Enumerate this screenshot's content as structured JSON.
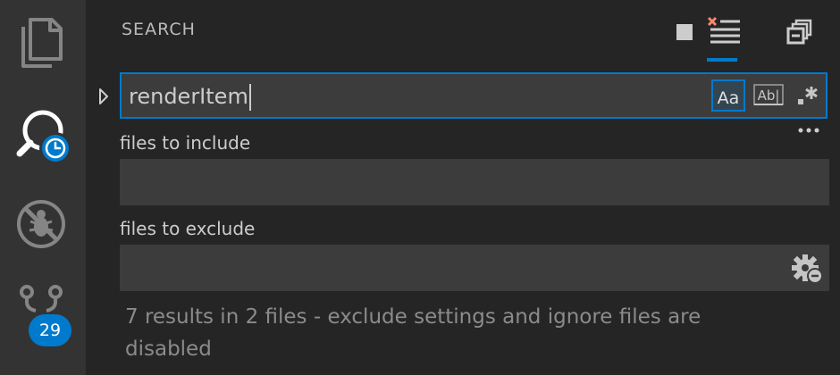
{
  "activity_bar": {
    "items": [
      {
        "name": "explorer",
        "icon": "files-icon"
      },
      {
        "name": "search",
        "icon": "search-history-icon"
      },
      {
        "name": "debug",
        "icon": "no-bug-icon"
      },
      {
        "name": "scm",
        "icon": "source-control-icon",
        "badge": "29"
      }
    ]
  },
  "search_panel": {
    "title": "SEARCH",
    "actions": [
      "stop-icon",
      "clear-results-icon",
      "collapse-all-icon"
    ],
    "query": "renderItem",
    "options": [
      "Aa",
      "Ab|",
      ".*"
    ],
    "more": "•••",
    "include_label": "files to include",
    "include_value": "",
    "exclude_label": "files to exclude",
    "exclude_value": "",
    "result_message": "7 results in 2 files - exclude settings and ignore files are disabled"
  },
  "colors": {
    "accent": "#007acc",
    "activity_bar": "#333333",
    "sidebar": "#252526",
    "input": "#3c3c3c"
  }
}
